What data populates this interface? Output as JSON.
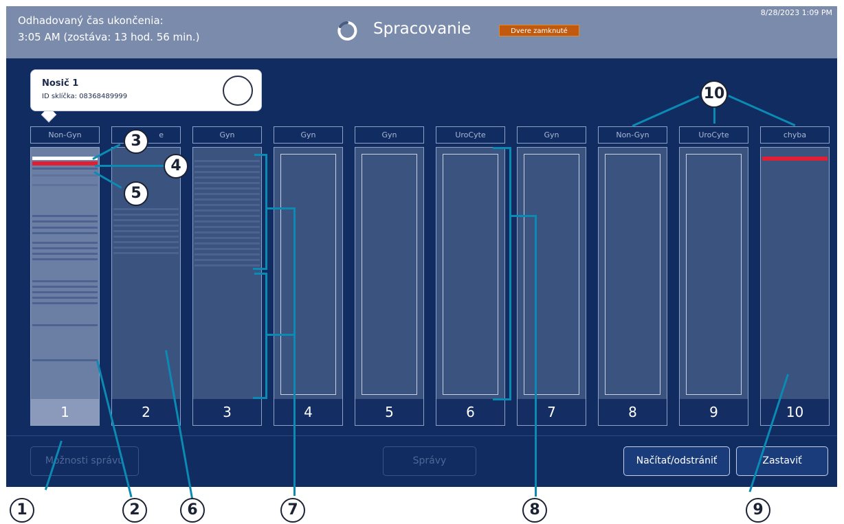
{
  "topbar": {
    "eta_line1": "Odhadovaný čas ukončenia:",
    "eta_line2": "3:05 AM (zostáva: 13 hod. 56 min.)",
    "title": "Spracovanie",
    "door_status": "Dvere zamknuté",
    "clock": "8/28/2023 1:09 PM"
  },
  "tooltip": {
    "title": "Nosič 1",
    "slide_id": "ID sklíčka: 08368489999"
  },
  "racks": [
    {
      "label": "Non-Gyn",
      "number": "1"
    },
    {
      "label": "e",
      "number": "2"
    },
    {
      "label": "Gyn",
      "number": "3"
    },
    {
      "label": "Gyn",
      "number": "4"
    },
    {
      "label": "Gyn",
      "number": "5"
    },
    {
      "label": "UroCyte",
      "number": "6"
    },
    {
      "label": "Gyn",
      "number": "7"
    },
    {
      "label": "Non-Gyn",
      "number": "8"
    },
    {
      "label": "UroCyte",
      "number": "9"
    },
    {
      "label": "chyba",
      "number": "10"
    }
  ],
  "buttons": {
    "manage_options": "Možnosti správu",
    "messages": "Správy",
    "load_remove": "Načítať/odstrániť",
    "stop": "Zastaviť"
  },
  "callouts": [
    "1",
    "2",
    "3",
    "4",
    "5",
    "6",
    "7",
    "8",
    "9",
    "10"
  ],
  "colors": {
    "background": "#112c60",
    "topbar": "#7b8bab",
    "door_badge": "#c1590f",
    "error_slide": "#e01f35",
    "callout_line": "#0b8ab3"
  },
  "icons": {
    "processing": "spinner-icon",
    "tooltip_image": "avatar-circle"
  }
}
